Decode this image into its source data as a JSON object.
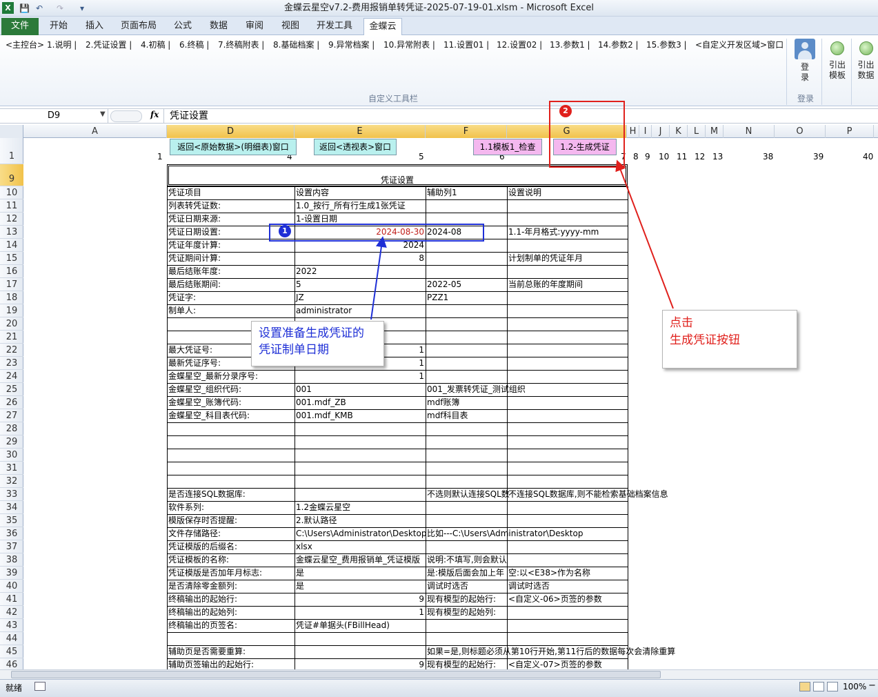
{
  "window": {
    "title": "金蝶云星空v7.2-费用报销单转凭证-2025-07-19-01.xlsm  -  Microsoft Excel"
  },
  "tabs": {
    "file": "文件",
    "home": "开始",
    "insert": "插入",
    "layout": "页面布局",
    "formula": "公式",
    "data": "数据",
    "review": "审阅",
    "view": "视图",
    "dev": "开发工具",
    "kingdee": "金蝶云"
  },
  "ribbon": {
    "links": [
      "<主控台>",
      "1.说明 |",
      "2.凭证设置 |",
      "4.初稿 |",
      "6.终稿 |",
      "7.终稿附表 |",
      "8.基础档案 |",
      "9.异常档案 |",
      "10.异常附表 |",
      "11.设置01 |",
      "12.设置02 |",
      "13.参数1 |",
      "14.参数2 |",
      "15.参数3 |",
      "<自定义开发区域>窗口"
    ],
    "group_label": "自定义工具栏",
    "login_label": "登\n录",
    "login_group": "登录",
    "export_template": "引出\n模板",
    "export_data": "引出\n数据"
  },
  "formula_bar": {
    "name_box": "D9",
    "fx": "fx",
    "content": "凭证设置"
  },
  "columns": [
    "A",
    "D",
    "E",
    "F",
    "G",
    "H",
    "I",
    "J",
    "K",
    "L",
    "M",
    "N",
    "O",
    "P"
  ],
  "rows": [
    "1",
    "9",
    "10",
    "11",
    "12",
    "13",
    "14",
    "15",
    "16",
    "17",
    "18",
    "19",
    "20",
    "21",
    "22",
    "23",
    "24",
    "25",
    "26",
    "27",
    "28",
    "29",
    "30",
    "31",
    "32",
    "33",
    "34",
    "35",
    "36",
    "37",
    "38",
    "39",
    "40",
    "41",
    "42",
    "43",
    "44",
    "45",
    "46"
  ],
  "row1_numbers": {
    "a": "1",
    "d": "4",
    "e": "5",
    "f": "6",
    "h": "7",
    "i": "8",
    "j": "9",
    "k": "10",
    "l": "11",
    "m": "12",
    "n": "13",
    "o": "38",
    "p": "39",
    "q": "40"
  },
  "sheet_buttons": {
    "back_raw": "返回<原始数据>(明细表)窗口",
    "back_pivot": "返回<透视表>窗口",
    "check": "1.1模板1_检查",
    "generate": "1.2-生成凭证"
  },
  "table": {
    "title": "凭证设置",
    "headers": [
      "凭证项目",
      "设置内容",
      "辅助列1",
      "设置说明"
    ],
    "rows": [
      {
        "d": "列表转凭证数:",
        "e": "1.0_按行_所有行生成1张凭证",
        "f": "",
        "g": ""
      },
      {
        "d": "凭证日期来源:",
        "e": "1-设置日期",
        "f": "",
        "g": ""
      },
      {
        "d": "凭证日期设置:",
        "e": "2024-08-30",
        "f": "2024-08",
        "g": "1.1-年月格式:yyyy-mm"
      },
      {
        "d": "凭证年度计算:",
        "e": "2024",
        "f": "",
        "g": ""
      },
      {
        "d": "凭证期间计算:",
        "e": "8",
        "f": "",
        "g": "计划制单的凭证年月"
      },
      {
        "d": "最后结账年度:",
        "e": "2022",
        "f": "",
        "g": ""
      },
      {
        "d": "最后结账期间:",
        "e": "5",
        "f": "2022-05",
        "g": "当前总账的年度期间"
      },
      {
        "d": "凭证字:",
        "e": "JZ",
        "f": "PZZ1",
        "g": ""
      },
      {
        "d": "制单人:",
        "e": "administrator",
        "f": "",
        "g": ""
      },
      {
        "d": "",
        "e": "",
        "f": "",
        "g": ""
      },
      {
        "d": "",
        "e": "",
        "f": "",
        "g": ""
      },
      {
        "d": "最大凭证号:",
        "e": "1",
        "f": "",
        "g": ""
      },
      {
        "d": "最新凭证序号:",
        "e": "1",
        "f": "",
        "g": ""
      },
      {
        "d": "金蝶星空_最新分录序号:",
        "e": "1",
        "f": "",
        "g": ""
      },
      {
        "d": "金蝶星空_组织代码:",
        "e": "001",
        "f": "001_发票转凭证_测试组织",
        "g": ""
      },
      {
        "d": "金蝶星空_账簿代码:",
        "e": "001.mdf_ZB",
        "f": "mdf账簿",
        "g": ""
      },
      {
        "d": "金蝶星空_科目表代码:",
        "e": "001.mdf_KMB",
        "f": "mdf科目表",
        "g": ""
      },
      {
        "d": "",
        "e": "",
        "f": "",
        "g": ""
      },
      {
        "d": "",
        "e": "",
        "f": "",
        "g": ""
      },
      {
        "d": "",
        "e": "",
        "f": "",
        "g": ""
      },
      {
        "d": "",
        "e": "",
        "f": "",
        "g": ""
      },
      {
        "d": "",
        "e": "",
        "f": "",
        "g": ""
      },
      {
        "d": "是否连接SQL数据库:",
        "e": "",
        "f": "不选则默认连接SQL数",
        "g": "不连接SQL数据库,则不能检索基础档案信息"
      },
      {
        "d": "软件系列:",
        "e": "1.2金蝶云星空",
        "f": "",
        "g": ""
      },
      {
        "d": "模版保存时否提醒:",
        "e": "2.默认路径",
        "f": "",
        "g": ""
      },
      {
        "d": "文件存储路径:",
        "e": "C:\\Users\\Administrator\\Desktop",
        "f": "比如---C:\\Users\\Administrator\\Desktop",
        "g": ""
      },
      {
        "d": "凭证模版的后缀名:",
        "e": "xlsx",
        "f": "",
        "g": ""
      },
      {
        "d": "凭证模板的名称:",
        "e": "金蝶云星空_费用报销单_凭证模版",
        "f": "说明:不填写,则会默认",
        "g": ""
      },
      {
        "d": "凭证模版是否加年月标志:",
        "e": "是",
        "f": "是:模版后面会加上年",
        "g": "空:以<E38>作为名称"
      },
      {
        "d": "是否清除零金额列:",
        "e": "是",
        "f": "调试时选否",
        "g": "调试时选否"
      },
      {
        "d": "终稿输出的起始行:",
        "e": "9",
        "f": "现有模型的起始行:",
        "g": "<自定义-06>页签的参数"
      },
      {
        "d": "终稿输出的起始列:",
        "e": "1",
        "f": "现有模型的起始列:",
        "g": ""
      },
      {
        "d": "终稿输出的页签名:",
        "e": "凭证#单据头(FBillHead)",
        "f": "",
        "g": ""
      },
      {
        "d": "",
        "e": "",
        "f": "",
        "g": ""
      },
      {
        "d": "辅助页是否需要重算:",
        "e": "",
        "f": "如果=是,则标题必须从第10行开始,第11行后的数据每次会清除重算",
        "g": ""
      },
      {
        "d": "辅助页签输出的起始行:",
        "e": "9",
        "f": "现有模型的起始行:",
        "g": "<自定义-07>页签的参数"
      }
    ]
  },
  "annotations": {
    "marker1": "1",
    "marker2": "2",
    "note1": "设置准备生成凭证的\n凭证制单日期",
    "note2": "点击\n生成凭证按钮"
  },
  "status": {
    "ready": "就绪",
    "zoom": "100%"
  },
  "colors": {
    "accent_red": "#e0201c",
    "accent_blue": "#1e2fd6",
    "file_tab": "#2c7a3a",
    "button_green": "#b9f0ee",
    "button_pink": "#f4b8ef"
  }
}
